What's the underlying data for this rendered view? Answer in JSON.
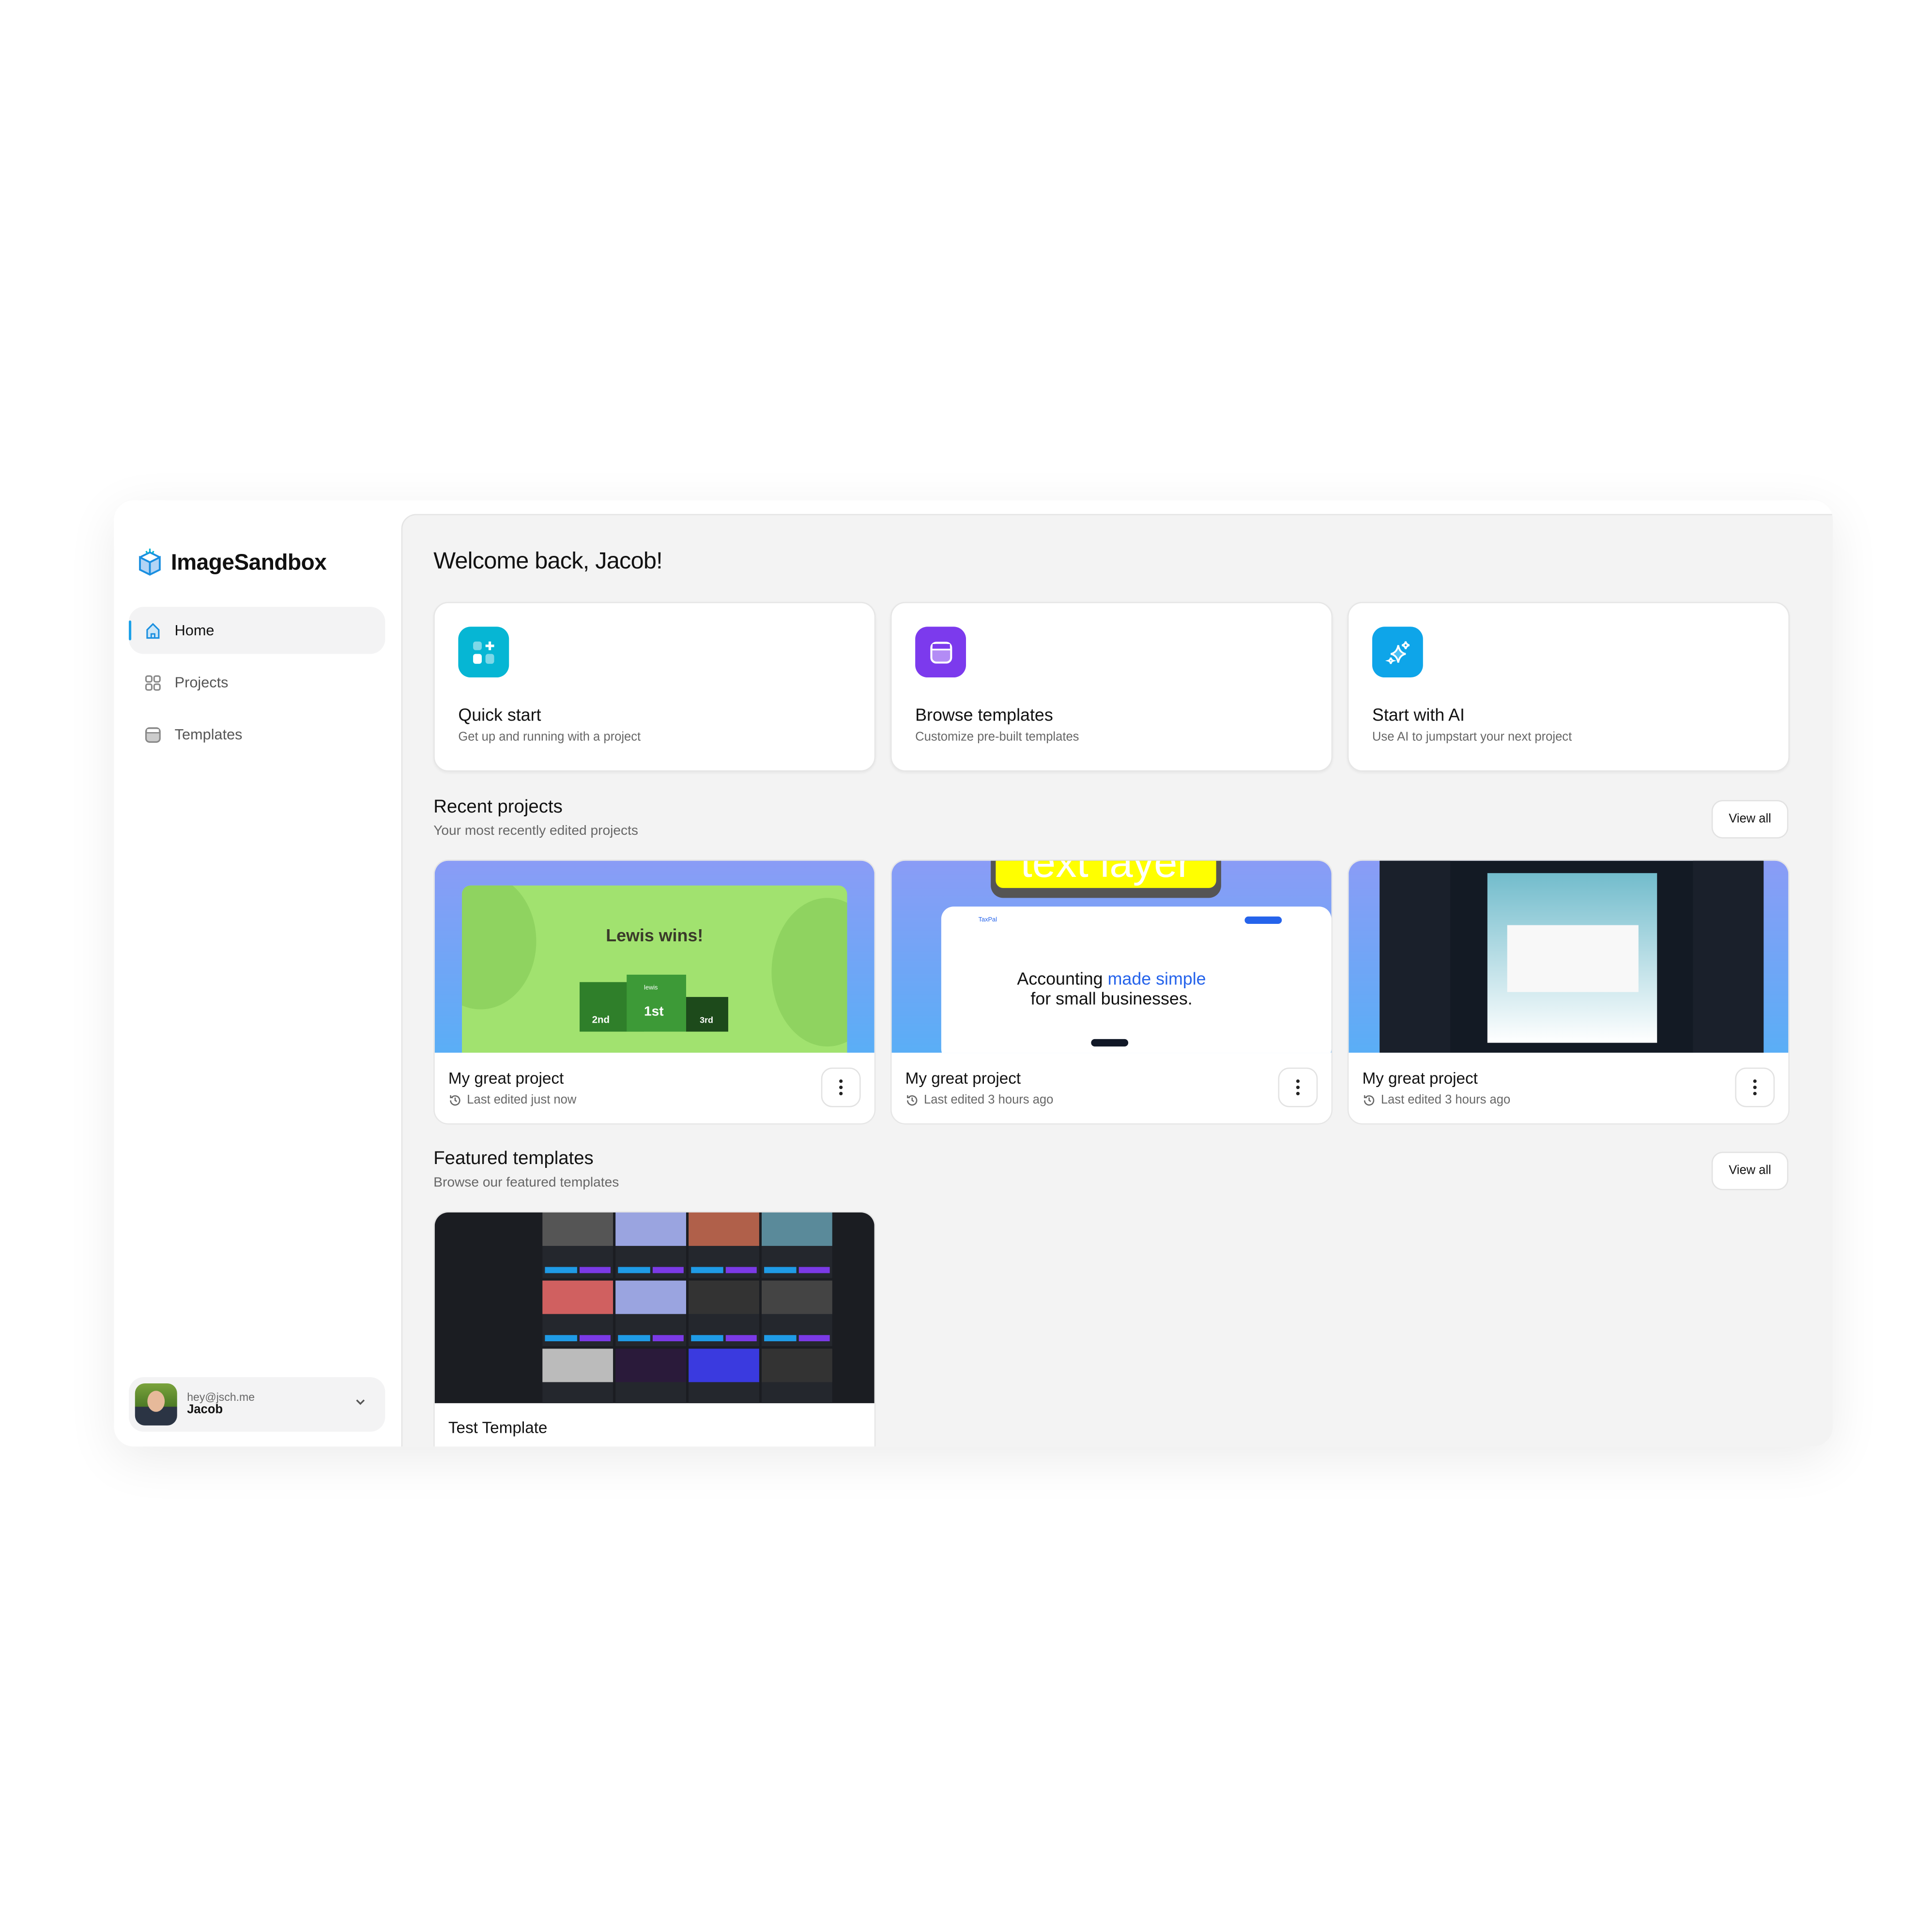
{
  "app": {
    "name": "ImageSandbox"
  },
  "sidebar": {
    "items": [
      {
        "label": "Home",
        "icon": "home-icon",
        "active": true
      },
      {
        "label": "Projects",
        "icon": "grid-icon"
      },
      {
        "label": "Templates",
        "icon": "template-icon"
      }
    ],
    "user": {
      "email": "hey@jsch.me",
      "name": "Jacob"
    }
  },
  "main": {
    "title": "Welcome back, Jacob!",
    "actions": [
      {
        "title": "Quick start",
        "subtitle": "Get up and running with a project",
        "icon": "quick-start-icon",
        "color": "#06b6d4"
      },
      {
        "title": "Browse templates",
        "subtitle": "Customize pre-built templates",
        "icon": "template-icon",
        "color": "#7c3aed"
      },
      {
        "title": "Start with AI",
        "subtitle": "Use AI to jumpstart your next project",
        "icon": "sparkles-icon",
        "color": "#0ea5e9"
      }
    ],
    "recent": {
      "heading": "Recent projects",
      "subheading": "Your most recently edited projects",
      "view_all": "View all",
      "projects": [
        {
          "name": "My great project",
          "edited": "Last edited just now",
          "thumb": {
            "headline": "Lewis wins!",
            "first": "1st",
            "second": "2nd",
            "third": "3rd",
            "player": "lewis"
          }
        },
        {
          "name": "My great project",
          "edited": "Last edited 3 hours ago",
          "thumb": {
            "overlay": "text layer",
            "brand": "TaxPal",
            "headline_a": "Accounting ",
            "headline_b": "made simple",
            "headline_c": "for small businesses."
          }
        },
        {
          "name": "My great project",
          "edited": "Last edited 3 hours ago",
          "thumb": {}
        }
      ]
    },
    "featured": {
      "heading": "Featured templates",
      "subheading": "Browse our featured templates",
      "view_all": "View all",
      "templates": [
        {
          "name": "Test Template"
        }
      ]
    }
  }
}
